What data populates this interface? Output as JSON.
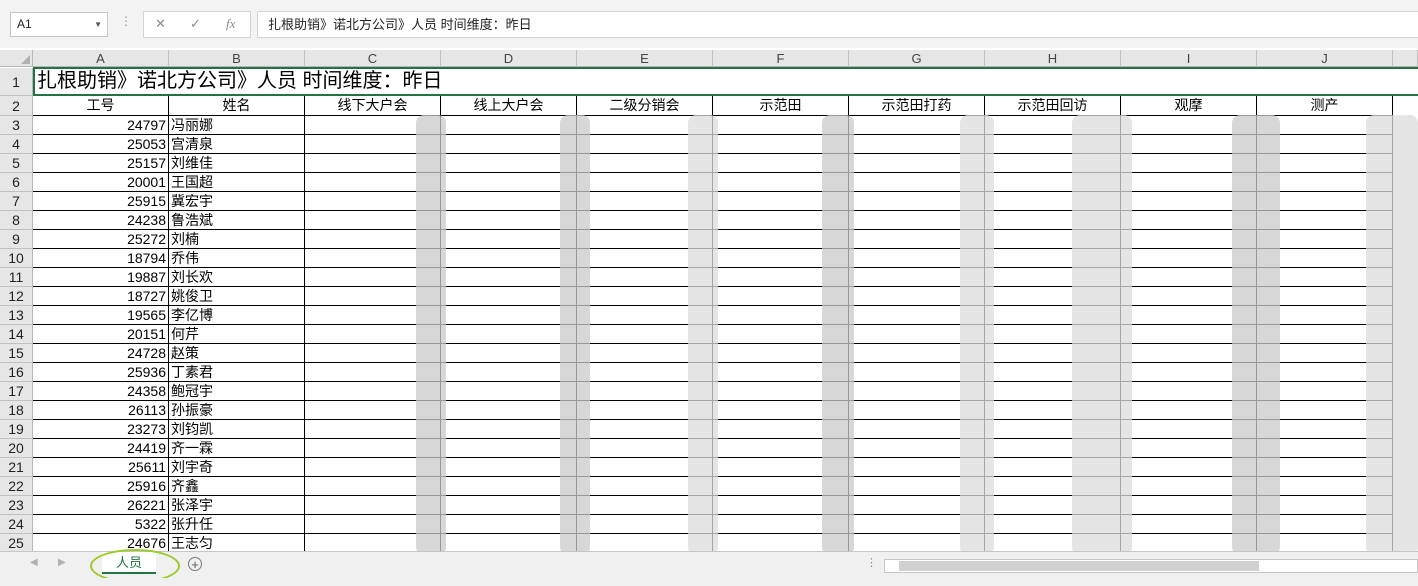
{
  "formula_bar": {
    "name_box": "A1",
    "cancel_glyph": "✕",
    "enter_glyph": "✓",
    "fx_label": "fx",
    "formula": "扎根助销》诺北方公司》人员  时间维度：昨日"
  },
  "columns": [
    "A",
    "B",
    "C",
    "D",
    "E",
    "F",
    "G",
    "H",
    "I",
    "J"
  ],
  "title": "扎根助销》诺北方公司》人员  时间维度：昨日",
  "headers": [
    "工号",
    "姓名",
    "线下大户会",
    "线上大户会",
    "二级分销会",
    "示范田",
    "示范田打药",
    "示范田回访",
    "观摩",
    "测产"
  ],
  "rows": [
    {
      "n": "3",
      "id": "24797",
      "name": "冯丽娜"
    },
    {
      "n": "4",
      "id": "25053",
      "name": "宫清泉"
    },
    {
      "n": "5",
      "id": "25157",
      "name": "刘维佳"
    },
    {
      "n": "6",
      "id": "20001",
      "name": "王国超"
    },
    {
      "n": "7",
      "id": "25915",
      "name": "冀宏宇"
    },
    {
      "n": "8",
      "id": "24238",
      "name": "鲁浩斌"
    },
    {
      "n": "9",
      "id": "25272",
      "name": "刘楠"
    },
    {
      "n": "10",
      "id": "18794",
      "name": "乔伟"
    },
    {
      "n": "11",
      "id": "19887",
      "name": "刘长欢"
    },
    {
      "n": "12",
      "id": "18727",
      "name": "姚俊卫"
    },
    {
      "n": "13",
      "id": "19565",
      "name": "李亿博"
    },
    {
      "n": "14",
      "id": "20151",
      "name": "何芹"
    },
    {
      "n": "15",
      "id": "24728",
      "name": "赵策"
    },
    {
      "n": "16",
      "id": "25936",
      "name": "丁素君"
    },
    {
      "n": "17",
      "id": "24358",
      "name": "鲍冠宇"
    },
    {
      "n": "18",
      "id": "26113",
      "name": "孙振豪"
    },
    {
      "n": "19",
      "id": "23273",
      "name": "刘钧凯"
    },
    {
      "n": "20",
      "id": "24419",
      "name": "齐一霖"
    },
    {
      "n": "21",
      "id": "25611",
      "name": "刘宇奇"
    },
    {
      "n": "22",
      "id": "25916",
      "name": "齐鑫"
    },
    {
      "n": "23",
      "id": "26221",
      "name": "张泽宇"
    },
    {
      "n": "24",
      "id": "5322",
      "name": "张升任"
    },
    {
      "n": "25",
      "id": "24676",
      "name": "王志匀"
    }
  ],
  "sheet_tabs": [
    "人员"
  ],
  "add_sheet_glyph": "+",
  "colors": {
    "accent": "#217346",
    "highlight_ring": "#9acb27"
  }
}
